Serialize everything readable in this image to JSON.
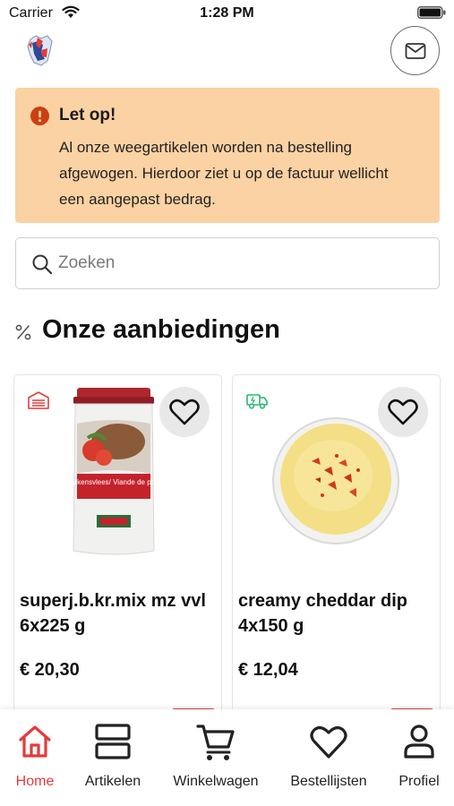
{
  "status_bar": {
    "carrier": "Carrier",
    "time": "1:28 PM"
  },
  "header": {
    "logo_icon": "brand-logo-icon",
    "mail_icon": "envelope-icon"
  },
  "notice": {
    "icon": "alert-circle-icon",
    "color": "#fbd2a3",
    "title": "Let op!",
    "body": "Al onze weegartikelen worden na bestelling afgewogen. Hierdoor ziet u op de factuur wellicht een aangepast bedrag."
  },
  "search": {
    "placeholder": "Zoeken",
    "value": ""
  },
  "offers": {
    "icon": "percent-icon",
    "title": "Onze aanbiedingen",
    "products": [
      {
        "badge_icon": "frozen-storage-icon",
        "badge_color": "#e43b3b",
        "name": "superj.b.kr.mix mz vvl 6x225 g",
        "price": "€ 20,30",
        "jar_label": "Varkensvlees/ Viande de porc"
      },
      {
        "badge_icon": "delivery-truck-icon",
        "badge_color": "#2bb673",
        "name": "creamy cheddar dip 4x150 g",
        "price": "€ 12,04"
      }
    ]
  },
  "tab_bar": {
    "active_color": "#e43b3b",
    "items": [
      {
        "label": "Home",
        "icon": "home-icon",
        "active": true
      },
      {
        "label": "Artikelen",
        "icon": "list-icon",
        "active": false
      },
      {
        "label": "Winkelwagen",
        "icon": "cart-icon",
        "active": false
      },
      {
        "label": "Bestellijsten",
        "icon": "heart-icon",
        "active": false
      },
      {
        "label": "Profiel",
        "icon": "user-icon",
        "active": false
      }
    ]
  }
}
